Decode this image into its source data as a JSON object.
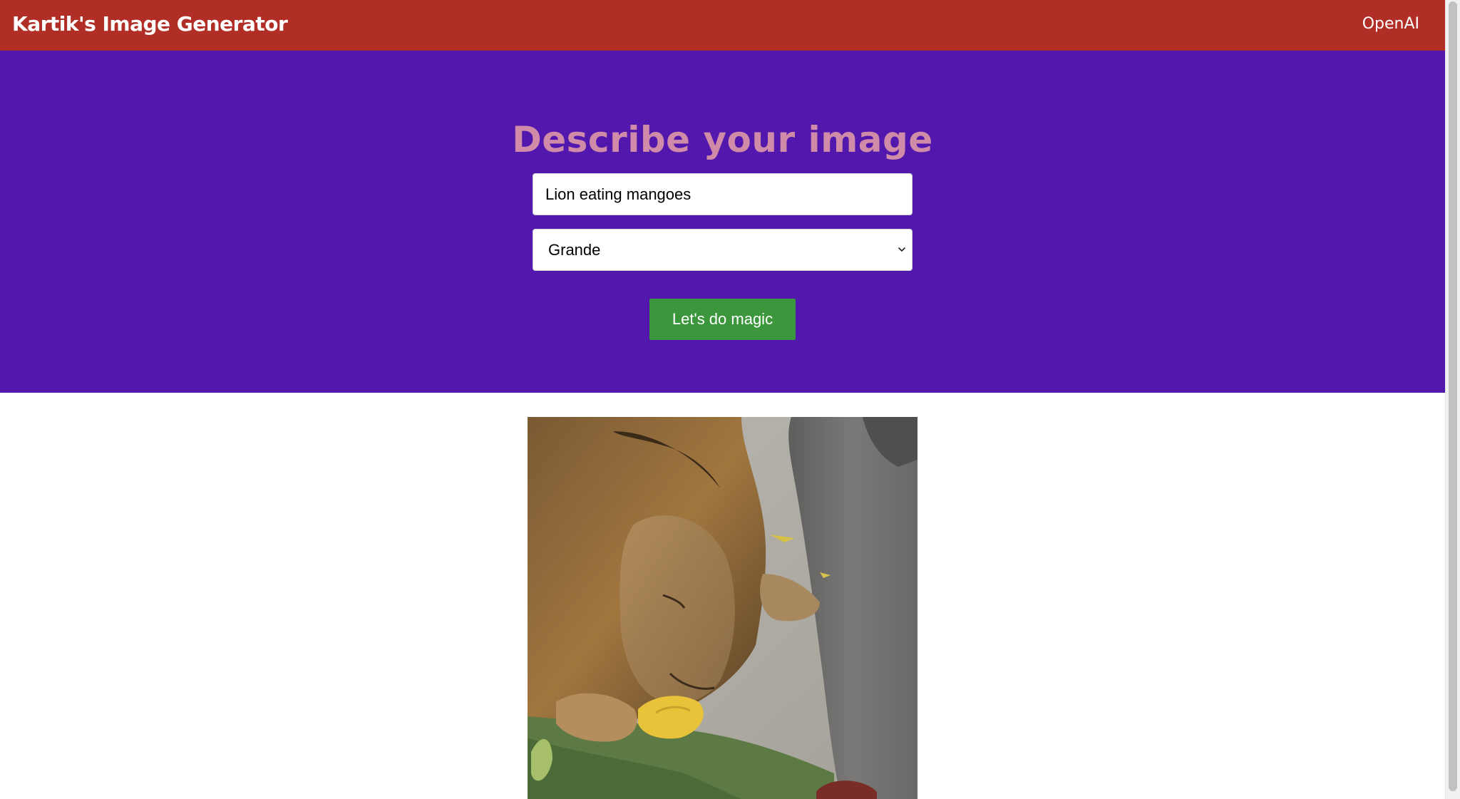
{
  "navbar": {
    "brand": "Kartik's Image Generator",
    "link": "OpenAI",
    "background_color": "#b02e26"
  },
  "hero": {
    "title": "Describe your image",
    "background_color": "#5218ad",
    "title_color": "#cf8ba8",
    "prompt": {
      "value": "Lion eating mangoes",
      "placeholder": ""
    },
    "size_select": {
      "selected": "Grande",
      "icon": "chevron-down-icon"
    },
    "submit_button": {
      "label": "Let's do magic",
      "color": "#3b963c"
    }
  },
  "result": {
    "image_alt": "Generated image of a lion eating mangoes"
  }
}
